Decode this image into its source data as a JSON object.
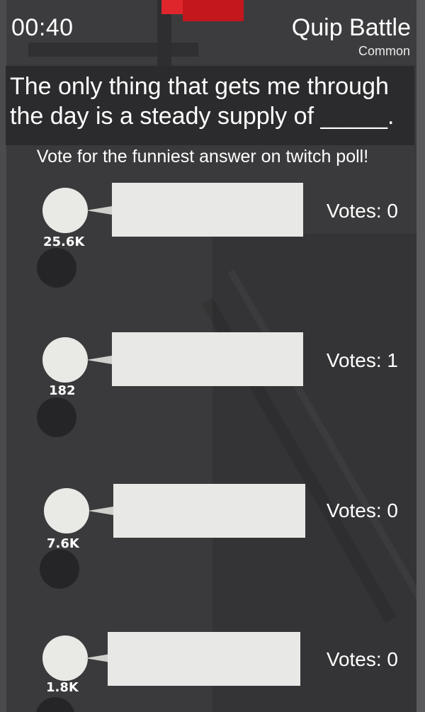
{
  "header": {
    "timer": "00:40",
    "title": "Quip Battle",
    "rarity": "Common"
  },
  "prompt": {
    "text": "The only thing that gets me through the day is a steady supply of _____."
  },
  "instruction": "Vote for the funniest answer on twitch poll!",
  "answers": [
    {
      "viewers": "25.6K",
      "votes_label": "Votes: 0",
      "votes": 0
    },
    {
      "viewers": "182",
      "votes_label": "Votes: 1",
      "votes": 1
    },
    {
      "viewers": "7.6K",
      "votes_label": "Votes: 0",
      "votes": 0
    },
    {
      "viewers": "1.8K",
      "votes_label": "Votes: 0",
      "votes": 0
    }
  ],
  "colors": {
    "background": "#3a3a3c",
    "card": "#e8e8e6",
    "accent_red": "#c3161d"
  }
}
